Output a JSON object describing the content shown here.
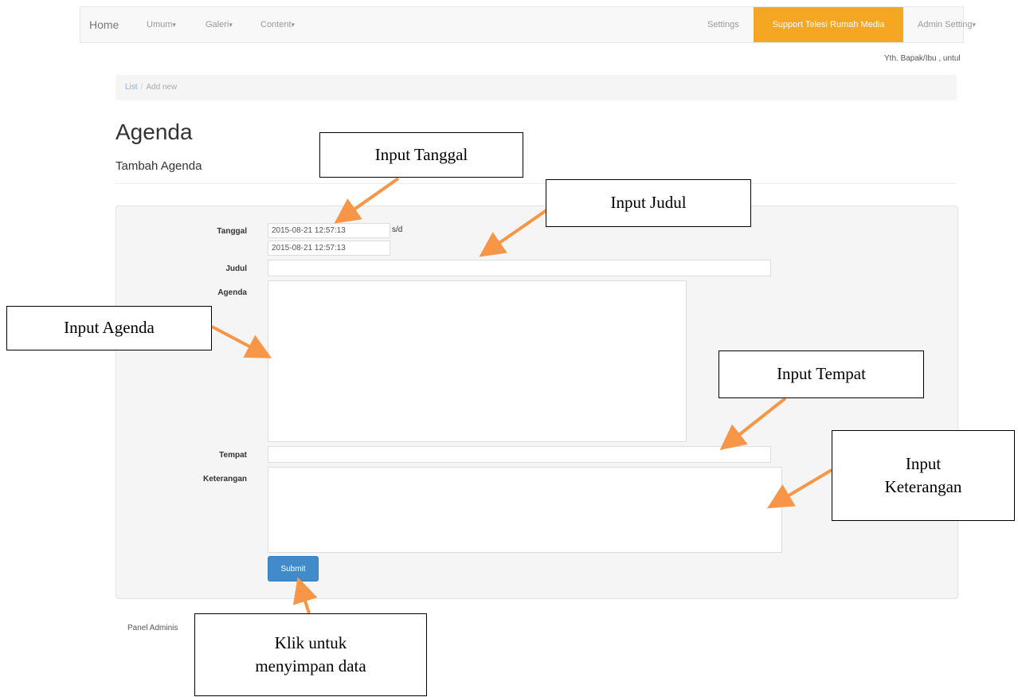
{
  "navbar": {
    "home": "Home",
    "menu_umum": "Umum",
    "menu_galeri": "Galeri",
    "menu_content": "Content",
    "settings": "Settings",
    "support": "Support Telesi Rumah Media",
    "admin_setting": "Admin Setting",
    "caret": "▾"
  },
  "greeting": "Yth. Bapak/Ibu , untul",
  "breadcrumb": {
    "list": "List",
    "separator": "/",
    "current": "Add new"
  },
  "page": {
    "title": "Agenda",
    "subtitle": "Tambah Agenda"
  },
  "form": {
    "tanggal_label": "Tanggal",
    "tanggal_start": "2015-08-21 12:57:13",
    "tanggal_end": "2015-08-21 12:57:13",
    "sd_label": "s/d",
    "judul_label": "Judul",
    "judul_value": "",
    "agenda_label": "Agenda",
    "agenda_value": "",
    "tempat_label": "Tempat",
    "tempat_value": "",
    "keterangan_label": "Keterangan",
    "keterangan_value": "",
    "submit_label": "Submit"
  },
  "footer": {
    "text": "Panel Adminis"
  },
  "annotations": {
    "tanggal": "Input Tanggal",
    "judul": "Input Judul",
    "agenda": "Input Agenda",
    "tempat": "Input Tempat",
    "keterangan_line1": "Input",
    "keterangan_line2": "Keterangan",
    "submit_line1": "Klik untuk",
    "submit_line2": "menyimpan data"
  },
  "colors": {
    "arrow": "#f79646",
    "nav_active": "#f5a623",
    "submit": "#428bca"
  }
}
